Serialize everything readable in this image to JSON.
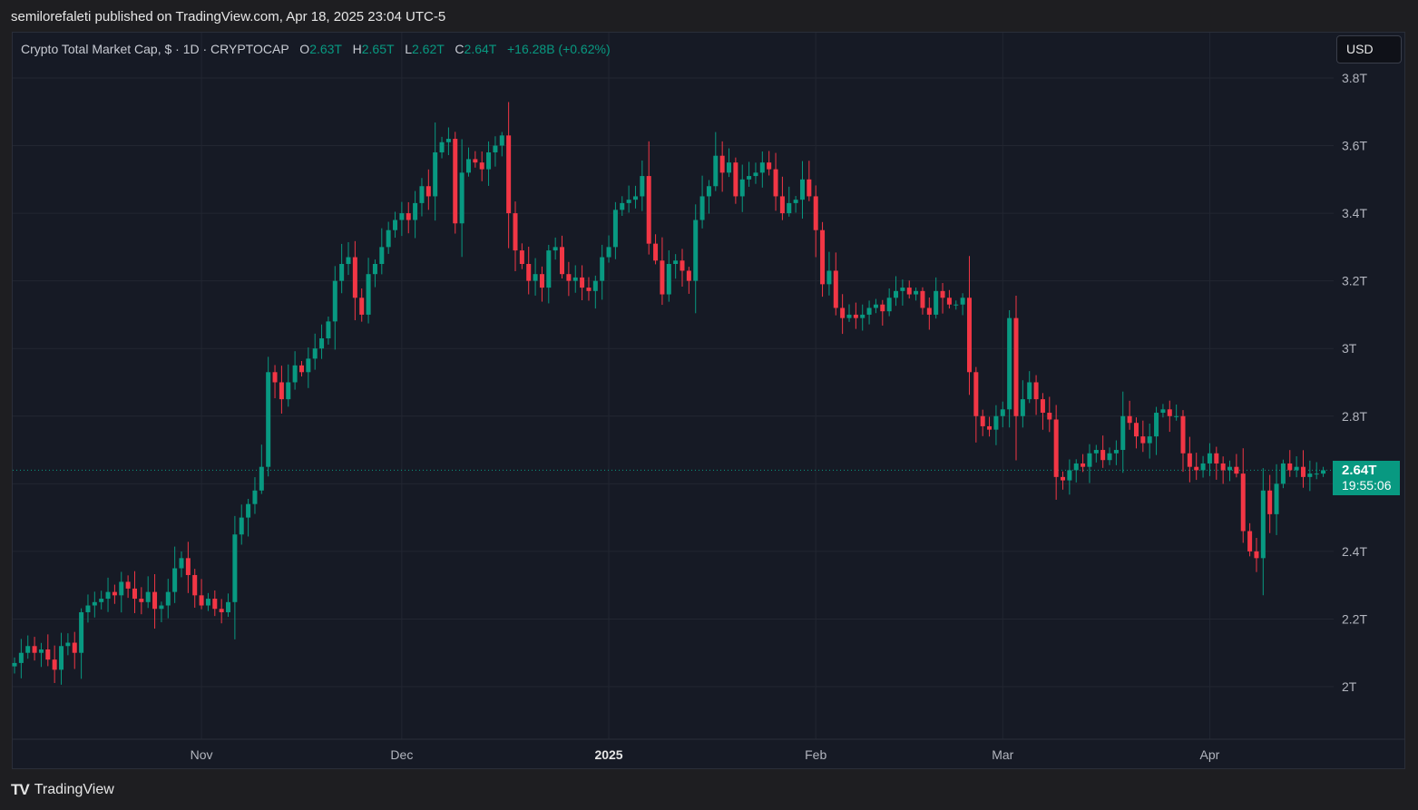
{
  "header": {
    "publish_note": "semilorefaleti published on TradingView.com, Apr 18, 2025 23:04 UTC-5"
  },
  "legend": {
    "symbol": "Crypto Total Market Cap, $ · 1D · CRYPTOCAP",
    "o_label": "O",
    "o": "2.63T",
    "h_label": "H",
    "h": "2.65T",
    "l_label": "L",
    "l": "2.62T",
    "c_label": "C",
    "c": "2.64T",
    "change": "+16.28B (+0.62%)"
  },
  "currency_button": "USD",
  "price_label": {
    "price": "2.64T",
    "countdown": "19:55:06"
  },
  "footer": {
    "brand": "TradingView",
    "logo": "TV"
  },
  "colors": {
    "up": "#089981",
    "down": "#f23645",
    "grid": "#222631",
    "bg": "#161a25"
  },
  "chart_data": {
    "type": "candlestick",
    "title": "Crypto Total Market Cap, $ · 1D · CRYPTOCAP",
    "start_date": "2024-10-04",
    "end_date": "2025-04-18",
    "first_open": 2.06,
    "closes": [
      2.07,
      2.1,
      2.12,
      2.1,
      2.11,
      2.08,
      2.05,
      2.12,
      2.13,
      2.1,
      2.22,
      2.24,
      2.25,
      2.26,
      2.28,
      2.27,
      2.31,
      2.29,
      2.26,
      2.25,
      2.28,
      2.23,
      2.24,
      2.28,
      2.35,
      2.38,
      2.33,
      2.27,
      2.24,
      2.26,
      2.23,
      2.22,
      2.25,
      2.45,
      2.5,
      2.54,
      2.58,
      2.65,
      2.93,
      2.9,
      2.85,
      2.9,
      2.95,
      2.93,
      2.97,
      3.0,
      3.03,
      3.08,
      3.2,
      3.25,
      3.27,
      3.15,
      3.1,
      3.22,
      3.25,
      3.3,
      3.35,
      3.38,
      3.4,
      3.38,
      3.43,
      3.48,
      3.45,
      3.58,
      3.61,
      3.62,
      3.37,
      3.52,
      3.56,
      3.55,
      3.53,
      3.58,
      3.6,
      3.63,
      3.4,
      3.29,
      3.25,
      3.2,
      3.22,
      3.18,
      3.29,
      3.3,
      3.22,
      3.2,
      3.21,
      3.18,
      3.17,
      3.2,
      3.27,
      3.3,
      3.41,
      3.43,
      3.44,
      3.45,
      3.51,
      3.31,
      3.26,
      3.16,
      3.25,
      3.26,
      3.23,
      3.2,
      3.38,
      3.45,
      3.48,
      3.57,
      3.52,
      3.55,
      3.45,
      3.5,
      3.51,
      3.52,
      3.55,
      3.53,
      3.45,
      3.4,
      3.43,
      3.44,
      3.5,
      3.45,
      3.35,
      3.19,
      3.23,
      3.12,
      3.09,
      3.1,
      3.09,
      3.1,
      3.12,
      3.13,
      3.11,
      3.15,
      3.17,
      3.18,
      3.16,
      3.17,
      3.12,
      3.1,
      3.17,
      3.15,
      3.13,
      3.13,
      3.15,
      2.93,
      2.8,
      2.77,
      2.76,
      2.8,
      2.82,
      3.09,
      2.8,
      2.85,
      2.9,
      2.85,
      2.81,
      2.79,
      2.62,
      2.61,
      2.64,
      2.66,
      2.65,
      2.69,
      2.7,
      2.67,
      2.69,
      2.7,
      2.8,
      2.78,
      2.74,
      2.72,
      2.74,
      2.81,
      2.82,
      2.8,
      2.8,
      2.69,
      2.65,
      2.64,
      2.66,
      2.69,
      2.66,
      2.64,
      2.65,
      2.63,
      2.46,
      2.4,
      2.38,
      2.58,
      2.51,
      2.6,
      2.66,
      2.64,
      2.65,
      2.62,
      2.63,
      2.63,
      2.64
    ],
    "last_candle": {
      "open": 2.63,
      "high": 2.65,
      "low": 2.62,
      "close": 2.64
    },
    "current_price": 2.64,
    "y_ticks": [
      {
        "v": 2.0,
        "label": "2T"
      },
      {
        "v": 2.2,
        "label": "2.2T"
      },
      {
        "v": 2.4,
        "label": "2.4T"
      },
      {
        "v": 2.6,
        "label": "2.6T"
      },
      {
        "v": 2.8,
        "label": "2.8T"
      },
      {
        "v": 3.0,
        "label": "3T"
      },
      {
        "v": 3.2,
        "label": "3.2T"
      },
      {
        "v": 3.4,
        "label": "3.4T"
      },
      {
        "v": 3.6,
        "label": "3.6T"
      },
      {
        "v": 3.8,
        "label": "3.8T"
      }
    ],
    "x_ticks": [
      {
        "index": 28,
        "label": "Nov"
      },
      {
        "index": 58,
        "label": "Dec"
      },
      {
        "index": 89,
        "label": "2025",
        "bold": true
      },
      {
        "index": 120,
        "label": "Feb"
      },
      {
        "index": 148,
        "label": "Mar"
      },
      {
        "index": 179,
        "label": "Apr"
      }
    ],
    "ylim": [
      1.85,
      3.85
    ],
    "grid": true
  }
}
